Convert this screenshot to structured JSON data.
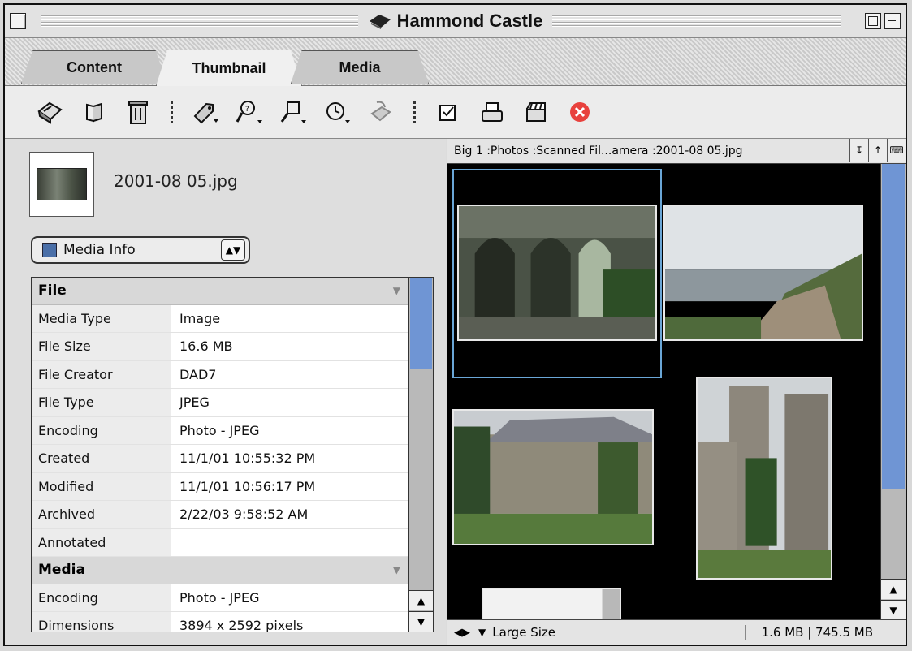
{
  "window": {
    "title": "Hammond Castle"
  },
  "tabs": [
    {
      "label": "Content",
      "active": false
    },
    {
      "label": "Thumbnail",
      "active": true
    },
    {
      "label": "Media",
      "active": false
    }
  ],
  "toolbar": {
    "icons": [
      "catalog-icon",
      "folder-icon",
      "trash-icon",
      "label-icon",
      "search-icon",
      "find-icon",
      "timer-icon",
      "rotate-icon",
      "checkbox-icon",
      "print-icon",
      "slideshow-icon",
      "stop-icon"
    ],
    "stop_color": "#e8413d"
  },
  "selected_item": {
    "filename": "2001-08 05.jpg"
  },
  "info_popup": {
    "label": "Media Info"
  },
  "info": {
    "file_section": "File",
    "file_rows": [
      {
        "key": "Media Type",
        "value": "Image"
      },
      {
        "key": "File Size",
        "value": "16.6 MB"
      },
      {
        "key": "File Creator",
        "value": "DAD7"
      },
      {
        "key": "File Type",
        "value": "JPEG"
      },
      {
        "key": "Encoding",
        "value": "Photo - JPEG"
      },
      {
        "key": "Created",
        "value": "11/1/01 10:55:32 PM"
      },
      {
        "key": "Modified",
        "value": "11/1/01 10:56:17 PM"
      },
      {
        "key": "Archived",
        "value": "2/22/03 9:58:52 AM"
      },
      {
        "key": "Annotated",
        "value": ""
      }
    ],
    "media_section": "Media",
    "media_rows": [
      {
        "key": "Encoding",
        "value": "Photo - JPEG"
      },
      {
        "key": "Dimensions",
        "value": "3894 x 2592 pixels"
      }
    ]
  },
  "viewer": {
    "path": "Big 1 :Photos :Scanned Fil...amera :2001-08 05.jpg",
    "size_mode": "Large Size",
    "status": "1.6 MB | 745.5 MB"
  },
  "colors": {
    "accent": "#6f95d4",
    "selection": "#6aa6d6"
  }
}
